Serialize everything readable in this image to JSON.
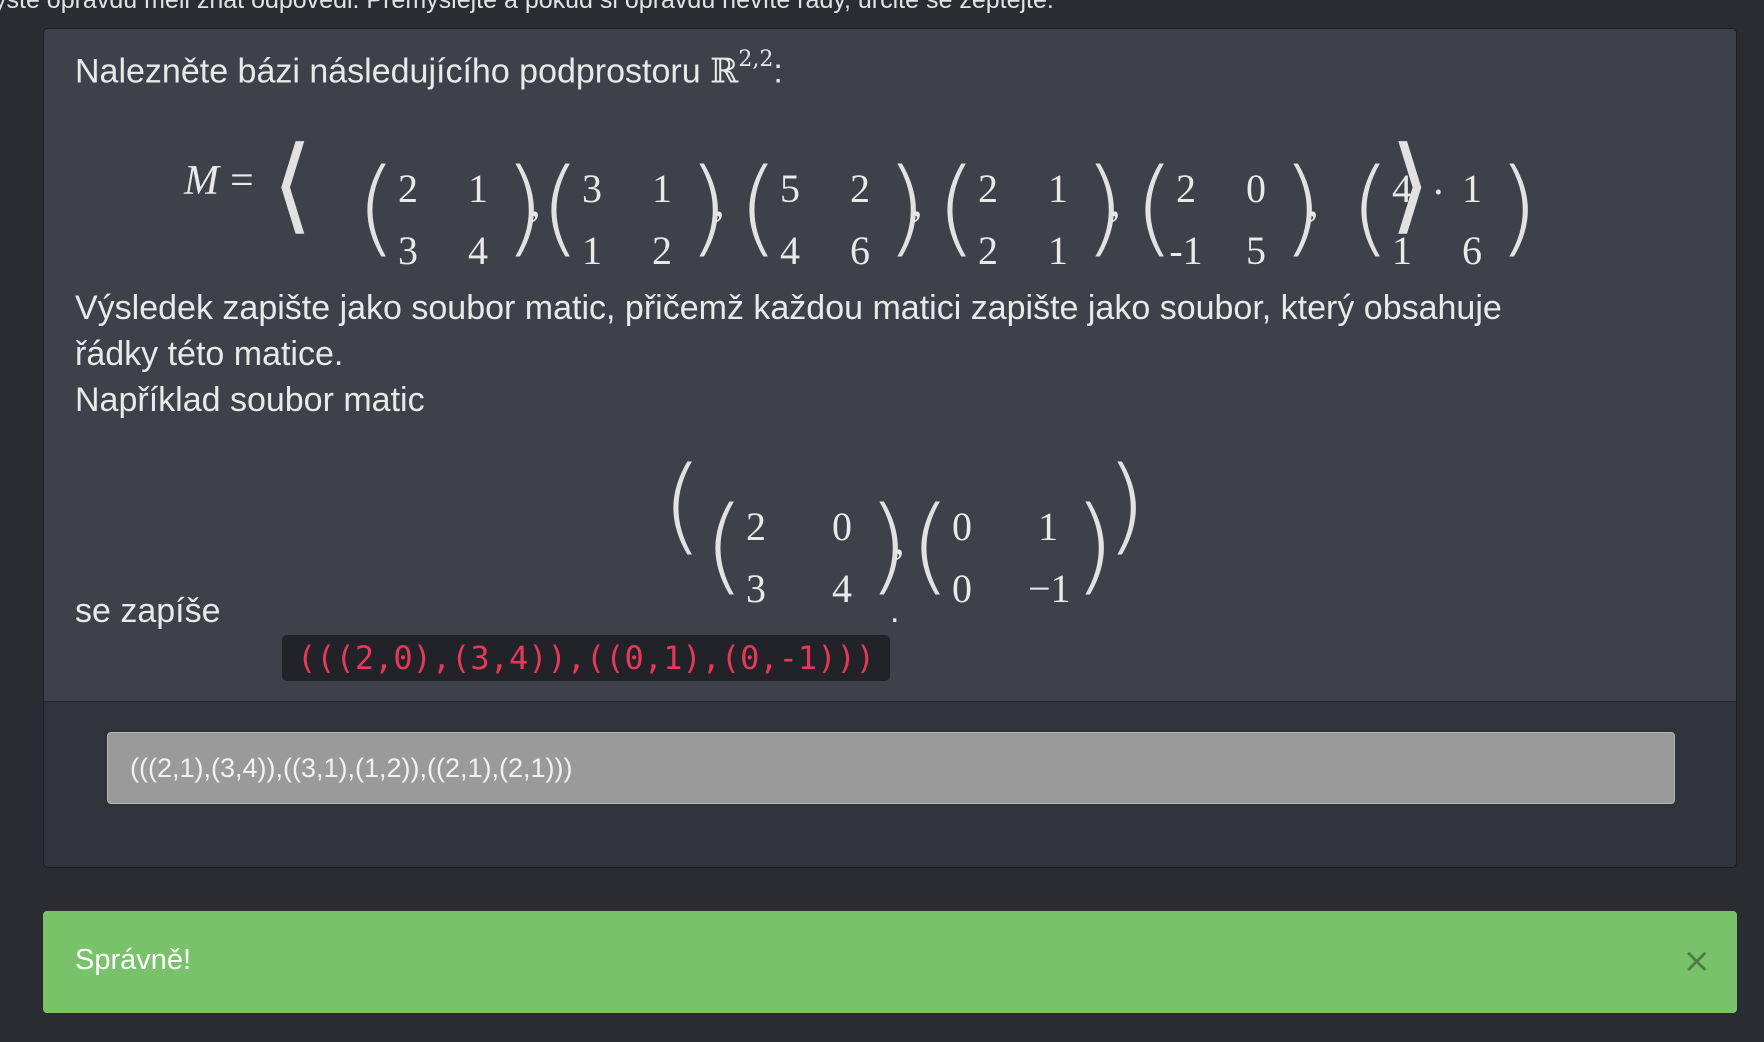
{
  "header": {
    "intro_text": "yste opravdu měli znát odpovědi. Přemýšlejte a pokud si opravdu nevíte rady, určitě se zeptejte."
  },
  "task": {
    "prompt_prefix": "Nalezněte bázi následujícího podprostoru ",
    "space_symbol": "ℝ",
    "space_exponent": "2,2",
    "prompt_suffix": ":",
    "set_label": "M",
    "equals": "=",
    "matrices": [
      [
        [
          "2",
          "1"
        ],
        [
          "3",
          "4"
        ]
      ],
      [
        [
          "3",
          "1"
        ],
        [
          "1",
          "2"
        ]
      ],
      [
        [
          "5",
          "2"
        ],
        [
          "4",
          "6"
        ]
      ],
      [
        [
          "2",
          "1"
        ],
        [
          "2",
          "1"
        ]
      ],
      [
        [
          "2",
          "0"
        ],
        [
          "-1",
          "5"
        ]
      ],
      [
        [
          "4",
          "1"
        ],
        [
          "1",
          "6"
        ]
      ]
    ],
    "instructions_line1": "Výsledek zapište jako soubor matic, přičemž každou matici zapište jako soubor, který obsahuje",
    "instructions_line2": "řádky této matice.",
    "example_heading": "Například soubor matic",
    "example_matrices": [
      [
        [
          "2",
          "0"
        ],
        [
          "3",
          "4"
        ]
      ],
      [
        [
          "0",
          "1"
        ],
        [
          "0",
          "−1"
        ]
      ]
    ],
    "example_written_prefix": "se zapíše ",
    "example_code": "(((2,0),(3,4)),((0,1),(0,-1)))",
    "example_written_suffix": "."
  },
  "answer": {
    "value": "(((2,1),(3,4)),((3,1),(1,2)),((2,1),(2,1)))"
  },
  "feedback": {
    "message": "Správně!",
    "close_symbol": "×"
  },
  "colors": {
    "background": "#2a2c31",
    "card": "#3e4149",
    "code_text": "#e8385a",
    "success": "#78c36a"
  }
}
